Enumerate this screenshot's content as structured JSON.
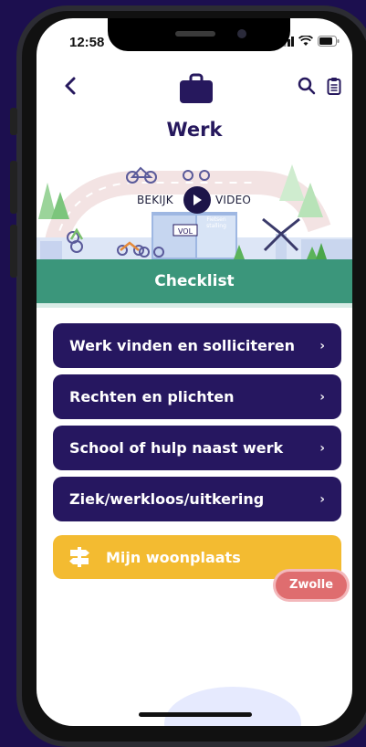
{
  "status": {
    "time": "12:58"
  },
  "page": {
    "title": "Werk"
  },
  "video": {
    "bekijk": "BEKIJK",
    "video": "VIDEO"
  },
  "illustration": {
    "sign_vol": "VOL",
    "sign_fiets": "Fietsen stalling"
  },
  "section": {
    "title": "Checklist"
  },
  "menu": [
    {
      "label": "Werk vinden en solliciteren",
      "chevron": "›"
    },
    {
      "label": "Rechten en plichten",
      "chevron": "›"
    },
    {
      "label": "School of hulp naast werk",
      "chevron": "›"
    },
    {
      "label": "Ziek/werkloos/uitkering",
      "chevron": "›"
    }
  ],
  "location": {
    "label": "Mijn woonplaats",
    "city": "Zwolle"
  },
  "colors": {
    "primary": "#261760",
    "accent_green": "#3b967b",
    "accent_yellow": "#f3bb31",
    "badge_red": "#df6d6f",
    "background": "#1c0f4f"
  },
  "icons": [
    "back-icon",
    "briefcase-icon",
    "search-icon",
    "clipboard-icon",
    "play-icon",
    "signpost-icon",
    "chevron-right-icon"
  ]
}
